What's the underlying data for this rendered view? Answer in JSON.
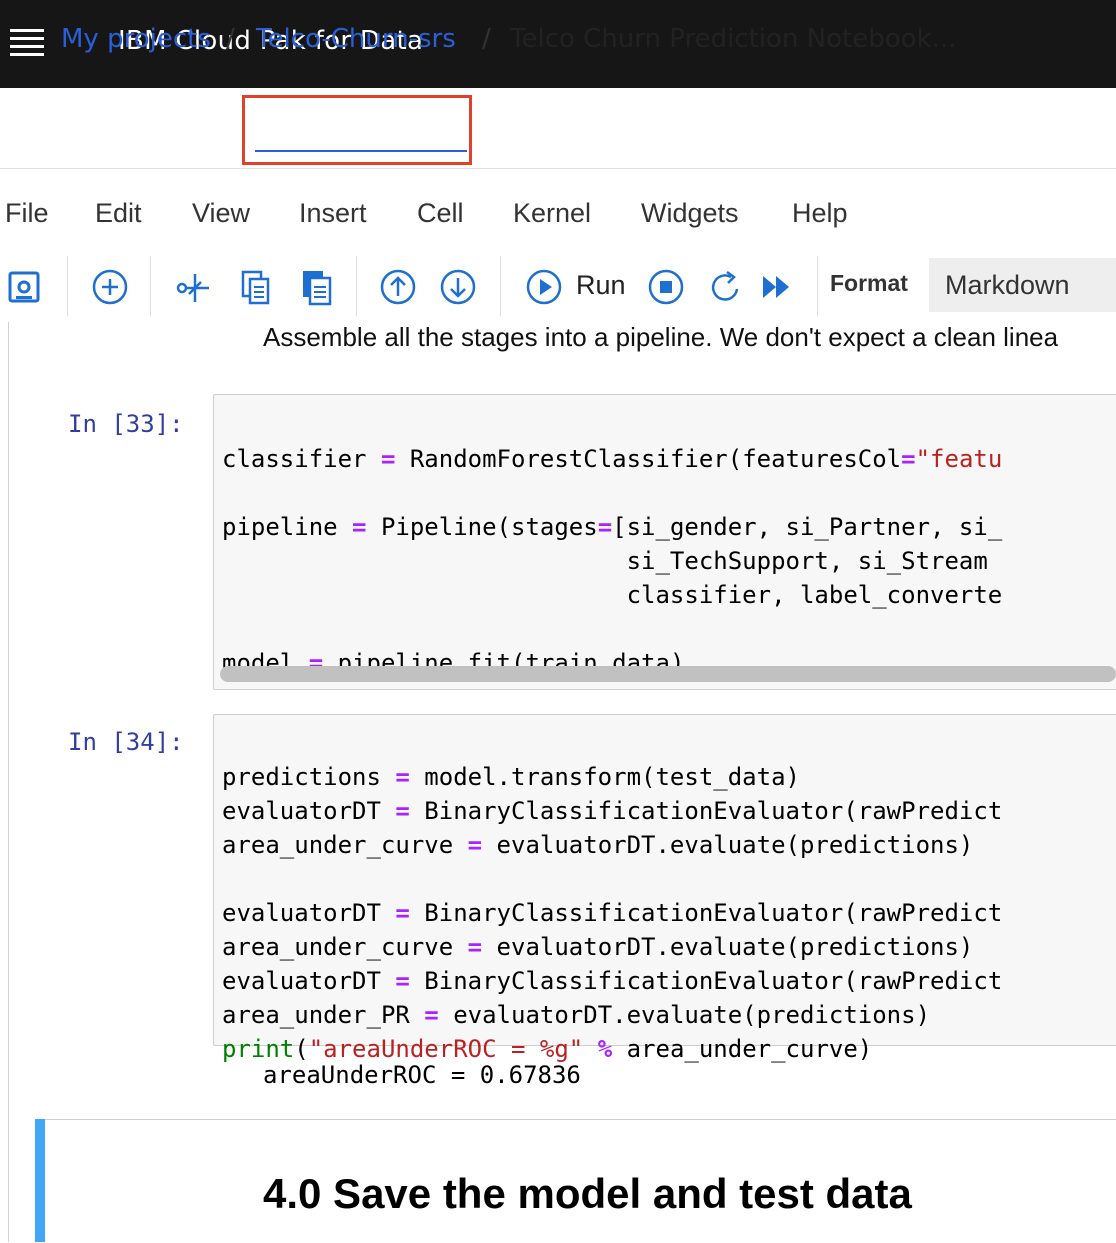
{
  "header": {
    "app_title": "IBM Cloud Pak for Data",
    "menu_icon": "hamburger-menu-icon"
  },
  "breadcrumb": {
    "items": [
      "My projects",
      "Telco-Churn-srs",
      "Telco Churn Prediction Notebook..."
    ],
    "separator": "/"
  },
  "menubar": {
    "items": [
      "File",
      "Edit",
      "View",
      "Insert",
      "Cell",
      "Kernel",
      "Widgets",
      "Help"
    ]
  },
  "toolbar": {
    "icons": [
      "save-icon",
      "add-cell-icon",
      "cut-icon",
      "copy-icon",
      "paste-icon",
      "move-up-icon",
      "move-down-icon",
      "run-icon",
      "stop-icon",
      "restart-icon",
      "run-all-icon"
    ],
    "run_label": "Run",
    "format_label": "Format",
    "format_value": "Markdown"
  },
  "notebook": {
    "markdown_text": "Assemble all the stages into a pipeline. We don't expect a clean linea",
    "cell33": {
      "prompt": "In [33]:",
      "lines": [
        "classifier = RandomForestClassifier(featuresCol=\"featu",
        "",
        "pipeline = Pipeline(stages=[si_gender, si_Partner, si_",
        "                            si_TechSupport, si_Stream",
        "                            classifier, label_converte",
        "",
        "model = pipeline.fit(train_data)"
      ]
    },
    "cell34": {
      "prompt": "In [34]:",
      "lines": [
        "predictions = model.transform(test_data)",
        "evaluatorDT = BinaryClassificationEvaluator(rawPredict",
        "area_under_curve = evaluatorDT.evaluate(predictions)",
        "",
        "evaluatorDT = BinaryClassificationEvaluator(rawPredict",
        "area_under_curve = evaluatorDT.evaluate(predictions)",
        "evaluatorDT = BinaryClassificationEvaluator(rawPredict",
        "area_under_PR = evaluatorDT.evaluate(predictions)",
        "print(\"areaUnderROC = %g\" % area_under_curve)"
      ],
      "output": "areaUnderROC = 0.67836"
    },
    "heading": "4.0 Save the model and test data"
  },
  "colors": {
    "link": "#2a5fd8",
    "highlight": "#e0412b",
    "topbar": "#161616",
    "md_bar": "#42a5f5"
  }
}
